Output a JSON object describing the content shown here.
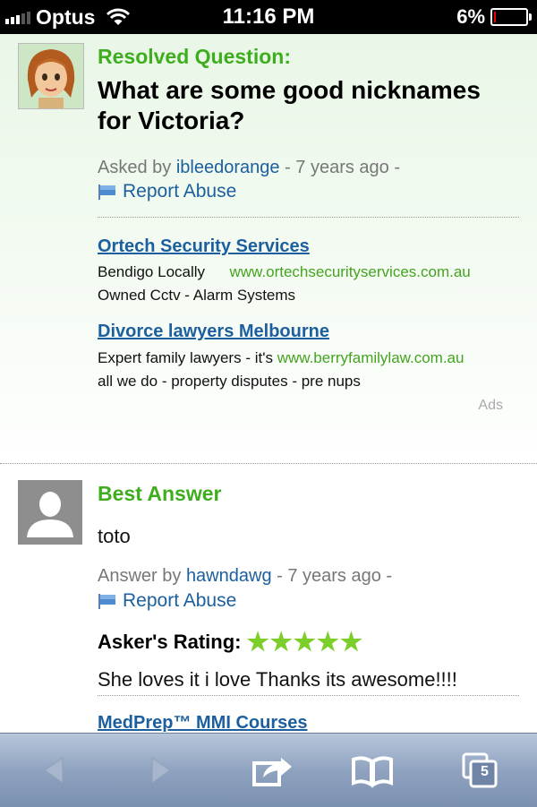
{
  "status_bar": {
    "carrier": "Optus",
    "time": "11:16 PM",
    "battery_percent": "6%",
    "battery_level": 0.06
  },
  "question": {
    "resolved_label": "Resolved Question:",
    "title": "What are some good nicknames for Victoria?",
    "asked_by_prefix": "Asked by",
    "asker": "ibleedorange",
    "asked_age": "- 7 years ago -",
    "report_abuse": "Report Abuse"
  },
  "ads": {
    "items": [
      {
        "title": "Ortech Security Services",
        "line1_text": "Bendigo Locally",
        "url": "www.ortechsecurityservices.com.au",
        "line2": "Owned Cctv - Alarm Systems"
      },
      {
        "title": "Divorce lawyers Melbourne",
        "line1_text": "Expert family lawyers - it's",
        "url": "www.berryfamilylaw.com.au",
        "line2": "all we do - property disputes - pre nups"
      }
    ],
    "label": "Ads"
  },
  "answer": {
    "best_label": "Best Answer",
    "text": "toto",
    "answer_by_prefix": "Answer by",
    "answerer": "hawndawg",
    "answer_age": "- 7 years ago -",
    "report_abuse": "Report Abuse",
    "rating_label": "Asker's Rating:",
    "rating_stars": "★★★★★",
    "rating_value": 5,
    "comment": "She loves it i love Thanks its awesome!!!!"
  },
  "next_ad": {
    "title": "MedPrep™ MMI Courses"
  },
  "toolbar": {
    "icons": [
      "back-arrow-icon",
      "forward-arrow-icon",
      "share-icon",
      "bookmarks-icon",
      "tabs-icon"
    ],
    "tab_count": "5"
  }
}
